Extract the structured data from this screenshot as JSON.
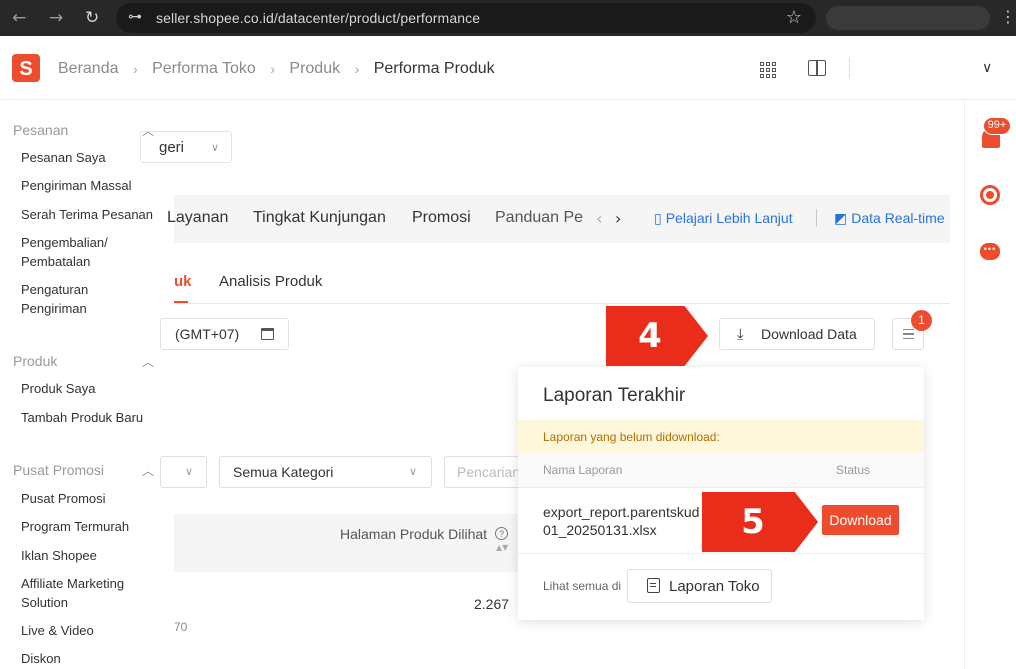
{
  "browser": {
    "url": "seller.shopee.co.id/datacenter/product/performance",
    "back": "←",
    "forward": "→",
    "reload": "↻",
    "star": "☆",
    "menu": "⋮",
    "tune": "⊶"
  },
  "topbar": {
    "logo_letter": "S",
    "breadcrumbs": [
      "Beranda",
      "Performa Toko",
      "Produk",
      "Performa Produk"
    ],
    "sep": "›",
    "caret": "∨"
  },
  "sidebar": {
    "sections": [
      {
        "title": "Pesanan",
        "items": [
          "Pesanan Saya",
          "Pengiriman Massal",
          "Serah Terima Pesanan",
          "Pengembalian/ Pembatalan",
          "Pengaturan Pengiriman"
        ]
      },
      {
        "title": "Produk",
        "items": [
          "Produk Saya",
          "Tambah Produk Baru"
        ]
      },
      {
        "title": "Pusat Promosi",
        "items": [
          "Pusat Promosi",
          "Program Termurah",
          "Iklan Shopee",
          "Affiliate Marketing Solution",
          "Live & Video",
          "Diskon"
        ]
      }
    ],
    "caret": "︿"
  },
  "main": {
    "category_dropdown": "geri",
    "dd_caret": "∨",
    "tabs": [
      "Layanan",
      "Tingkat Kunjungan",
      "Promosi",
      "Panduan Pe"
    ],
    "arrow_left": "‹",
    "arrow_right": "›",
    "link_learn": "Pelajari Lebih Lanjut",
    "link_realtime": "Data Real-time",
    "subtab_active": "uk",
    "subtab_other": "Analisis Produk",
    "date_text": "(GMT+07)",
    "download_data": "Download Data",
    "download_icon": "⤓",
    "menu_badge": "1",
    "filter_category": "Semua Kategori",
    "search_placeholder": "Pencarian",
    "table_header": "Halaman Produk Dilihat",
    "help": "?",
    "sort": "▲▼",
    "cell_value": "2.267",
    "cell_sub": "70"
  },
  "rail": {
    "badge": "99+",
    "chat": "•••"
  },
  "popup": {
    "title": "Laporan Terakhir",
    "warning": "Laporan yang belum didownload:",
    "col_name": "Nama Laporan",
    "col_status": "Status",
    "file_name": "export_report.parentskudetail.20250101_20250131.xlsx",
    "file_display": "export_report.parentskud 101_20250131.xlsx",
    "download_button": "Download",
    "footer_label": "Lihat semua di",
    "report_button": "Laporan Toko"
  },
  "annotations": {
    "step4": "4",
    "step5": "5",
    "color": "#ea2c1a"
  },
  "colors": {
    "brand": "#ee4d2d",
    "link": "#2673dd",
    "warning_bg": "#fff7db"
  }
}
